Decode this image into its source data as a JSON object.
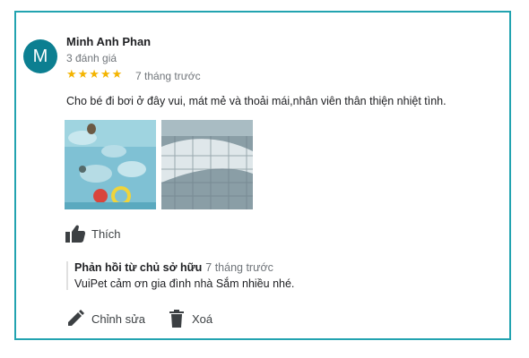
{
  "review": {
    "avatar_letter": "M",
    "avatar_color": "#0c7f91",
    "author_name": "Minh Anh Phan",
    "review_count": "3 đánh giá",
    "rating": 5,
    "stars_text": "★★★★★",
    "star_color": "#f4b400",
    "time": "7 tháng trước",
    "text": "Cho bé đi bơi ở đây vui, mát mẻ và thoải mái,nhân viên thân thiện nhiệt tình.",
    "photos": [
      "pool-photo",
      "pool-photo"
    ]
  },
  "like": {
    "icon": "thumbs-up-icon",
    "label": "Thích"
  },
  "owner_reply": {
    "label": "Phản hồi từ chủ sở hữu",
    "time": "7 tháng trước",
    "text": "VuiPet cảm ơn gia đình nhà Sắm nhiều nhé."
  },
  "actions": {
    "edit": {
      "icon": "pencil-icon",
      "label": "Chỉnh sửa"
    },
    "delete": {
      "icon": "trash-icon",
      "label": "Xoá"
    }
  },
  "accent_color": "#22a3b0"
}
